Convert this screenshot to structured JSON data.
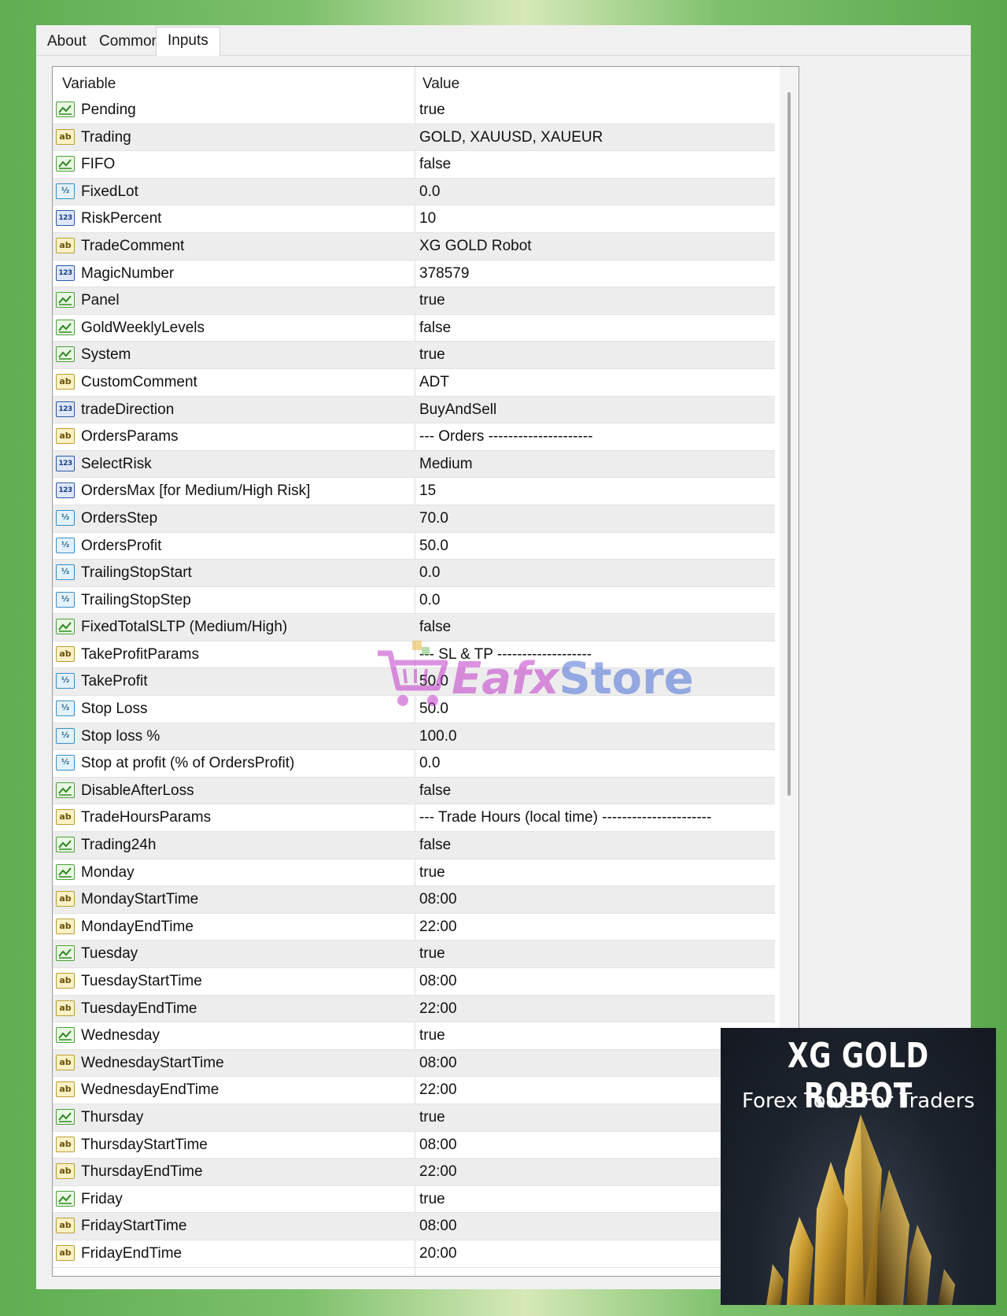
{
  "tabs": [
    {
      "label": "About"
    },
    {
      "label": "Common"
    },
    {
      "label": "Inputs"
    }
  ],
  "table": {
    "headers": {
      "variable": "Variable",
      "value": "Value"
    },
    "rows": [
      {
        "type": "bool",
        "name": "Pending",
        "value": "true"
      },
      {
        "type": "string",
        "name": "Trading",
        "value": "GOLD, XAUUSD, XAUEUR"
      },
      {
        "type": "bool",
        "name": "FIFO",
        "value": "false"
      },
      {
        "type": "double",
        "name": "FixedLot",
        "value": "0.0"
      },
      {
        "type": "int",
        "name": "RiskPercent",
        "value": "10"
      },
      {
        "type": "string",
        "name": "TradeComment",
        "value": "XG GOLD Robot"
      },
      {
        "type": "int",
        "name": "MagicNumber",
        "value": "378579"
      },
      {
        "type": "bool",
        "name": "Panel",
        "value": "true"
      },
      {
        "type": "bool",
        "name": "GoldWeeklyLevels",
        "value": "false"
      },
      {
        "type": "bool",
        "name": "System",
        "value": "true"
      },
      {
        "type": "string",
        "name": "CustomComment",
        "value": "ADT"
      },
      {
        "type": "int",
        "name": "tradeDirection",
        "value": "BuyAndSell"
      },
      {
        "type": "string",
        "name": "OrdersParams",
        "value": "--- Orders ---------------------"
      },
      {
        "type": "int",
        "name": "SelectRisk",
        "value": "Medium"
      },
      {
        "type": "int",
        "name": "OrdersMax [for Medium/High Risk]",
        "value": "15"
      },
      {
        "type": "double",
        "name": "OrdersStep",
        "value": "70.0"
      },
      {
        "type": "double",
        "name": "OrdersProfit",
        "value": "50.0"
      },
      {
        "type": "double",
        "name": "TrailingStopStart",
        "value": "0.0"
      },
      {
        "type": "double",
        "name": "TrailingStopStep",
        "value": "0.0"
      },
      {
        "type": "bool",
        "name": "FixedTotalSLTP (Medium/High)",
        "value": "false"
      },
      {
        "type": "string",
        "name": "TakeProfitParams",
        "value": "--- SL & TP -------------------"
      },
      {
        "type": "double",
        "name": "TakeProfit",
        "value": "50.0"
      },
      {
        "type": "double",
        "name": "Stop Loss",
        "value": "50.0"
      },
      {
        "type": "double",
        "name": "Stop loss %",
        "value": "100.0"
      },
      {
        "type": "double",
        "name": "Stop at profit (% of OrdersProfit)",
        "value": "0.0"
      },
      {
        "type": "bool",
        "name": "DisableAfterLoss",
        "value": "false"
      },
      {
        "type": "string",
        "name": "TradeHoursParams",
        "value": "--- Trade Hours (local time) ----------------------"
      },
      {
        "type": "bool",
        "name": "Trading24h",
        "value": "false"
      },
      {
        "type": "bool",
        "name": "Monday",
        "value": "true"
      },
      {
        "type": "string",
        "name": "MondayStartTime",
        "value": "08:00"
      },
      {
        "type": "string",
        "name": "MondayEndTime",
        "value": "22:00"
      },
      {
        "type": "bool",
        "name": "Tuesday",
        "value": "true"
      },
      {
        "type": "string",
        "name": "TuesdayStartTime",
        "value": "08:00"
      },
      {
        "type": "string",
        "name": "TuesdayEndTime",
        "value": "22:00"
      },
      {
        "type": "bool",
        "name": "Wednesday",
        "value": "true"
      },
      {
        "type": "string",
        "name": "WednesdayStartTime",
        "value": "08:00"
      },
      {
        "type": "string",
        "name": "WednesdayEndTime",
        "value": "22:00"
      },
      {
        "type": "bool",
        "name": "Thursday",
        "value": "true"
      },
      {
        "type": "string",
        "name": "ThursdayStartTime",
        "value": "08:00"
      },
      {
        "type": "string",
        "name": "ThursdayEndTime",
        "value": "22:00"
      },
      {
        "type": "bool",
        "name": "Friday",
        "value": "true"
      },
      {
        "type": "string",
        "name": "FridayStartTime",
        "value": "08:00"
      },
      {
        "type": "string",
        "name": "FridayEndTime",
        "value": "20:00"
      }
    ]
  },
  "icons": {
    "bool": "bool-icon",
    "string": "string-icon",
    "double": "double-icon",
    "int": "int-icon"
  },
  "icon_glyphs": {
    "string": "ab",
    "double": "½",
    "int": "123"
  },
  "watermark": {
    "text_part1": "Eafx",
    "text_part2": "Store"
  },
  "promo": {
    "title": "XG GOLD ROBOT",
    "subtitle": "Forex Tools For Traders"
  },
  "colors": {
    "background_green": "#6cb85c",
    "window": "#f0f0f0",
    "grid_alt_row": "#ededed",
    "bool_icon": "#4ca13c",
    "string_icon": "#b89e3a",
    "double_icon": "#3a8ec5",
    "int_icon": "#2c5aa8",
    "watermark_magenta": "#c23ac9",
    "watermark_blue": "#4b6fd6",
    "promo_bg": "#1d232c",
    "promo_gold": "#d9b24a"
  }
}
